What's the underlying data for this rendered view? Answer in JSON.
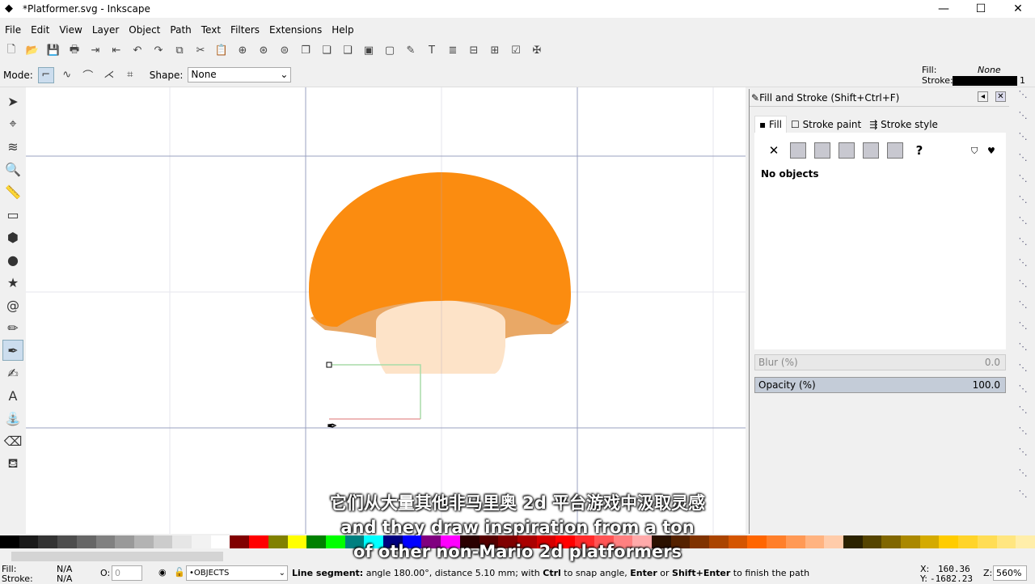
{
  "window": {
    "title": "*Platformer.svg - Inkscape",
    "min": "—",
    "max": "☐",
    "close": "✕"
  },
  "menu": [
    "File",
    "Edit",
    "View",
    "Layer",
    "Object",
    "Path",
    "Text",
    "Filters",
    "Extensions",
    "Help"
  ],
  "toolbar_icons": [
    "new-icon",
    "open-icon",
    "save-icon",
    "print-icon",
    "import-icon",
    "export-icon",
    "undo-icon",
    "redo-icon",
    "copy-icon",
    "cut-icon",
    "paste-icon",
    "zoom-selection-icon",
    "zoom-drawing-icon",
    "zoom-page-icon",
    "duplicate-icon",
    "clone-icon",
    "unlink-clone-icon",
    "group-icon",
    "ungroup-icon",
    "xml-editor-icon",
    "text-icon",
    "layers-icon",
    "fill-stroke-icon",
    "align-icon",
    "preferences-icon",
    "document-properties-icon"
  ],
  "controls": {
    "mode_label": "Mode:",
    "shape_label": "Shape:",
    "shape_value": "None"
  },
  "style_indicator": {
    "fill_label": "Fill:",
    "fill_value": "None",
    "stroke_label": "Stroke:",
    "stroke_width": "1",
    "stroke_color": "#000000"
  },
  "tools": [
    "selector",
    "node",
    "tweak",
    "zoom",
    "measure",
    "rectangle",
    "3d-box",
    "ellipse",
    "star",
    "spiral",
    "pencil",
    "pen",
    "calligraphy",
    "text",
    "spray",
    "eraser",
    "paint-bucket"
  ],
  "active_tool": "pen",
  "panel": {
    "title": "Fill and Stroke (Shift+Ctrl+F)",
    "tabs": [
      "Fill",
      "Stroke paint",
      "Stroke style"
    ],
    "active_tab": "Fill",
    "paint_types": [
      "✕",
      "",
      "",
      "",
      "",
      "",
      "?"
    ],
    "message": "No objects",
    "blur_label": "Blur (%)",
    "blur_value": "0.0",
    "opacity_label": "Opacity (%)",
    "opacity_value": "100.0"
  },
  "canvas": {
    "cap_color": "#fb8c10",
    "cap_under_color": "#e9a866",
    "stem_color": "#fde3c8"
  },
  "palette": [
    "#000000",
    "#1a1a1a",
    "#333333",
    "#4d4d4d",
    "#666666",
    "#808080",
    "#999999",
    "#b3b3b3",
    "#cccccc",
    "#e6e6e6",
    "#f2f2f2",
    "#ffffff",
    "#800000",
    "#ff0000",
    "#808000",
    "#ffff00",
    "#008000",
    "#00ff00",
    "#008080",
    "#00ffff",
    "#000080",
    "#0000ff",
    "#800080",
    "#ff00ff",
    "#2b0000",
    "#550000",
    "#800000",
    "#aa0000",
    "#d40000",
    "#ff0000",
    "#ff2a2a",
    "#ff5555",
    "#ff8080",
    "#ffaaaa",
    "#2b1100",
    "#552200",
    "#803300",
    "#aa4400",
    "#d45500",
    "#ff6600",
    "#ff7f2a",
    "#ff9955",
    "#ffb380",
    "#ffccaa",
    "#2b2200",
    "#554400",
    "#806600",
    "#aa8800",
    "#d4aa00",
    "#ffcc00",
    "#ffd42a",
    "#ffdd55",
    "#ffe680",
    "#ffeeaa"
  ],
  "subtitles": {
    "zh": "它们从大量其他非马里奥 2d 平台游戏中汲取灵感",
    "en1": "and they draw inspiration from a ton",
    "en2": "of other non-Mario 2d platformers"
  },
  "status": {
    "fill_label": "Fill:",
    "fill_value": "N/A",
    "stroke_label": "Stroke:",
    "stroke_value": "N/A",
    "opacity_label": "O:",
    "opacity_value": "0",
    "layer": "•OBJECTS",
    "msg_bold1": "Line segment:",
    "msg1": " angle 180.00°, distance 5.10 mm; with ",
    "msg_bold2": "Ctrl",
    "msg2": " to snap angle, ",
    "msg_bold3": "Enter",
    "msg3": " or ",
    "msg_bold4": "Shift+Enter",
    "msg4": " to finish the path",
    "x_label": "X:",
    "x": "160.36",
    "y_label": "Y:",
    "y": "-1682.23",
    "zoom_label": "Z:",
    "zoom": "560%"
  }
}
